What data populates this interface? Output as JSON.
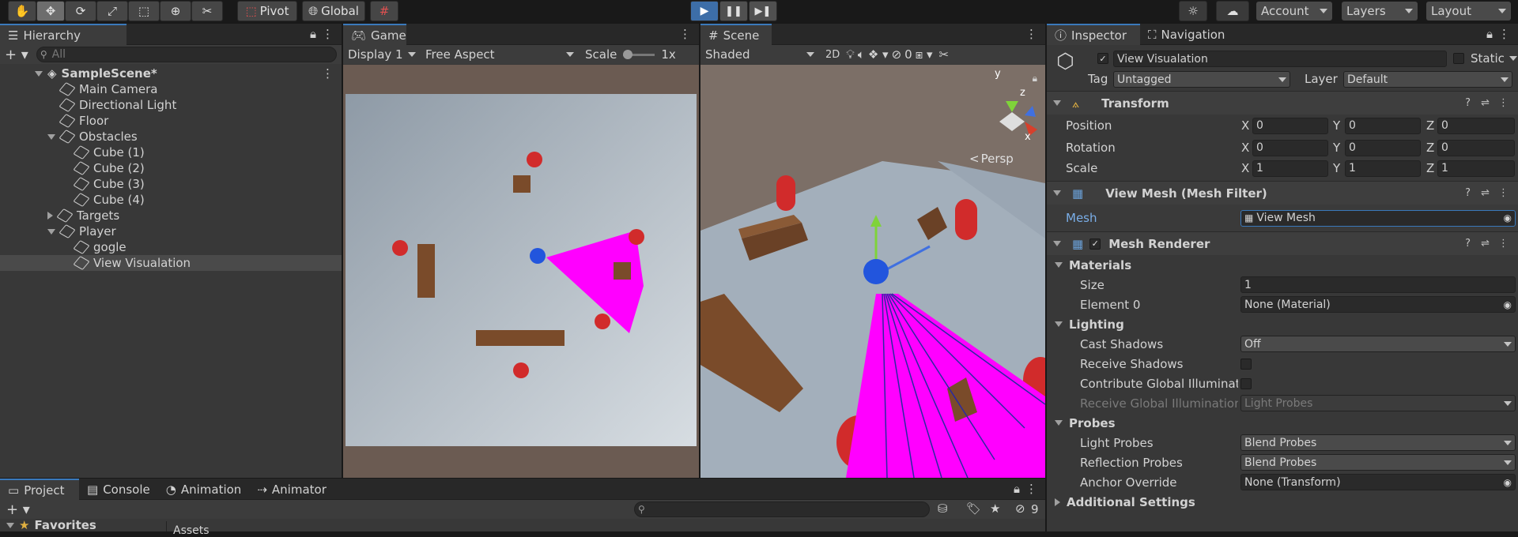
{
  "toolbar": {
    "pivot": "Pivot",
    "global": "Global",
    "account": "Account",
    "layers": "Layers",
    "layout": "Layout"
  },
  "hierarchy": {
    "title": "Hierarchy",
    "search_placeholder": "All",
    "scene": "SampleScene*",
    "items": [
      {
        "label": "Main Camera"
      },
      {
        "label": "Directional Light"
      },
      {
        "label": "Floor"
      },
      {
        "label": "Obstacles"
      },
      {
        "label": "Cube (1)"
      },
      {
        "label": "Cube (2)"
      },
      {
        "label": "Cube (3)"
      },
      {
        "label": "Cube (4)"
      },
      {
        "label": "Targets"
      },
      {
        "label": "Player"
      },
      {
        "label": "gogle"
      },
      {
        "label": "View Visualation"
      }
    ]
  },
  "game": {
    "tab": "Game",
    "display": "Display 1",
    "aspect": "Free Aspect",
    "scale_label": "Scale",
    "scale_value": "1x"
  },
  "scene": {
    "tab": "Scene",
    "shading": "Shaded",
    "mode_2d": "2D",
    "hidden_count": "0",
    "persp": "Persp",
    "gizmo_y": "y",
    "gizmo_z": "z",
    "gizmo_x": "x"
  },
  "inspector": {
    "tab": "Inspector",
    "nav_tab": "Navigation",
    "object_name": "View Visualation",
    "static": "Static",
    "tag_label": "Tag",
    "tag_value": "Untagged",
    "layer_label": "Layer",
    "layer_value": "Default",
    "transform": {
      "title": "Transform",
      "position": "Position",
      "rotation": "Rotation",
      "scale": "Scale",
      "pos": [
        "0",
        "0",
        "0"
      ],
      "rot": [
        "0",
        "0",
        "0"
      ],
      "scl": [
        "1",
        "1",
        "1"
      ],
      "x": "X",
      "y": "Y",
      "z": "Z"
    },
    "mesh_filter": {
      "title": "View Mesh (Mesh Filter)",
      "mesh_label": "Mesh",
      "mesh_value": "View Mesh"
    },
    "mesh_renderer": {
      "title": "Mesh Renderer",
      "materials": "Materials",
      "size_label": "Size",
      "size_value": "1",
      "element0_label": "Element 0",
      "element0_value": "None (Material)",
      "lighting": "Lighting",
      "cast_shadows_label": "Cast Shadows",
      "cast_shadows_value": "Off",
      "receive_shadows_label": "Receive Shadows",
      "contribute_gi_label": "Contribute Global Illuminatic",
      "receive_gi_label": "Receive Global Illumination",
      "receive_gi_value": "Light Probes",
      "probes": "Probes",
      "light_probes_label": "Light Probes",
      "light_probes_value": "Blend Probes",
      "reflection_probes_label": "Reflection Probes",
      "reflection_probes_value": "Blend Probes",
      "anchor_label": "Anchor Override",
      "anchor_value": "None (Transform)",
      "additional": "Additional Settings"
    }
  },
  "bottom": {
    "tabs": [
      "Project",
      "Console",
      "Animation",
      "Animator"
    ],
    "favorites": "Favorites",
    "assets": "Assets",
    "hidden_count": "9"
  },
  "colors": {
    "accent": "#3a79bb",
    "play_active": "#3d6ea8",
    "magenta": "#ff00ff"
  }
}
